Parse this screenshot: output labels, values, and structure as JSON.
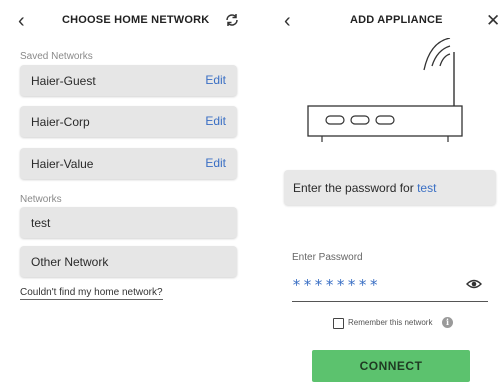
{
  "choose_network": {
    "title": "CHOOSE HOME NETWORK",
    "back_icon": "chevron-left-icon",
    "refresh_icon": "refresh-icon",
    "saved_label": "Saved Networks",
    "saved": [
      {
        "name": "Haier-Guest",
        "edit": "Edit"
      },
      {
        "name": "Haier-Corp",
        "edit": "Edit"
      },
      {
        "name": "Haier-Value",
        "edit": "Edit"
      }
    ],
    "networks_label": "Networks",
    "networks": [
      {
        "name": "test"
      },
      {
        "name": "Other Network"
      }
    ],
    "help_link": "Couldn't find my home network?"
  },
  "add_appliance": {
    "title": "ADD APPLIANCE",
    "back_icon": "chevron-left-icon",
    "close_icon": "close-icon",
    "router_icon": "router-illustration",
    "prompt_prefix": "Enter the password for ",
    "prompt_network": "test",
    "password_label": "Enter Password",
    "password_value": "********",
    "show_password_icon": "eye-icon",
    "remember_label": "Remember this network",
    "remember_checked": false,
    "info_icon": "info-icon",
    "connect_label": "CONNECT"
  },
  "colors": {
    "accent_blue": "#3a6fc4",
    "connect_green": "#5cc26e",
    "row_gray": "#e6e6e6"
  }
}
